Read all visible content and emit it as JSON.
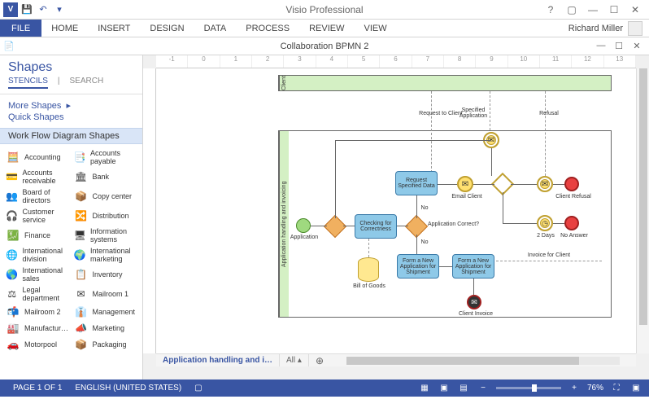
{
  "app": {
    "title": "Visio Professional",
    "user": "Richard Miller"
  },
  "qat": {
    "visio": "V",
    "save": "💾",
    "undo": "↶",
    "dropdown": "▾"
  },
  "ribbon": [
    "FILE",
    "HOME",
    "INSERT",
    "DESIGN",
    "DATA",
    "PROCESS",
    "REVIEW",
    "VIEW"
  ],
  "winbtns": {
    "help": "?",
    "ribbon_toggle": "▢",
    "min": "—",
    "max": "☐",
    "close": "✕"
  },
  "doc": {
    "title": "Collaboration BPMN 2",
    "min": "—",
    "max": "☐",
    "close": "✕"
  },
  "shapes": {
    "heading": "Shapes",
    "tabs": {
      "stencils": "STENCILS",
      "search": "SEARCH"
    },
    "more": "More Shapes",
    "quick": "Quick Shapes",
    "stencil": "Work Flow Diagram Shapes",
    "items": [
      {
        "icon": "🧮",
        "label": "Accounting"
      },
      {
        "icon": "📑",
        "label": "Accounts payable"
      },
      {
        "icon": "💳",
        "label": "Accounts receivable"
      },
      {
        "icon": "🏛",
        "label": "Bank"
      },
      {
        "icon": "👥",
        "label": "Board of directors"
      },
      {
        "icon": "📦",
        "label": "Copy center"
      },
      {
        "icon": "🎧",
        "label": "Customer service"
      },
      {
        "icon": "🔀",
        "label": "Distribution"
      },
      {
        "icon": "💹",
        "label": "Finance"
      },
      {
        "icon": "🖥",
        "label": "Information systems"
      },
      {
        "icon": "🌐",
        "label": "International division"
      },
      {
        "icon": "🌍",
        "label": "International marketing"
      },
      {
        "icon": "🌎",
        "label": "International sales"
      },
      {
        "icon": "📋",
        "label": "Inventory"
      },
      {
        "icon": "⚖",
        "label": "Legal department"
      },
      {
        "icon": "✉",
        "label": "Mailroom 1"
      },
      {
        "icon": "📬",
        "label": "Mailroom 2"
      },
      {
        "icon": "👔",
        "label": "Management"
      },
      {
        "icon": "🏭",
        "label": "Manufactur…"
      },
      {
        "icon": "📣",
        "label": "Marketing"
      },
      {
        "icon": "🚗",
        "label": "Motorpool"
      },
      {
        "icon": "📦",
        "label": "Packaging"
      }
    ]
  },
  "ruler_marks": [
    "-1",
    "0",
    "1",
    "2",
    "3",
    "4",
    "5",
    "6",
    "7",
    "8",
    "9",
    "10",
    "11",
    "12",
    "13"
  ],
  "diagram": {
    "pool_client": "Client",
    "pool_app": "Application handling and invoicing",
    "start": "Application",
    "task_check": "Checking for Correctness",
    "task_request": "Request Specified Data",
    "task_email": "Email Client",
    "task_form1": "Form a New Application for Shipment",
    "task_form2": "Form a New Application for Shipment",
    "store": "Bill of Goods",
    "lbl_request_client": "Request to Client",
    "lbl_app_correct": "Application Correct?",
    "lbl_no1": "No",
    "lbl_no2": "No",
    "lbl_spec_app": "Specified Application",
    "lbl_refusal": "Refusal",
    "lbl_client_refusal": "Client Refusal",
    "lbl_2days": "2 Days",
    "lbl_no_answer": "No Answer",
    "lbl_invoice": "Invoice for Client",
    "lbl_client_invoice": "Client Invoice"
  },
  "page_tabs": {
    "current": "Application handling and i…",
    "all": "All",
    "all_arrow": "▴",
    "add": "⊕"
  },
  "status": {
    "page": "PAGE 1 OF 1",
    "lang": "ENGLISH (UNITED STATES)",
    "rec": "▢",
    "views": [
      "▦",
      "▣",
      "▤"
    ],
    "minus": "−",
    "plus": "+",
    "zoom": "76%",
    "fit": "⛶",
    "full": "▣"
  }
}
